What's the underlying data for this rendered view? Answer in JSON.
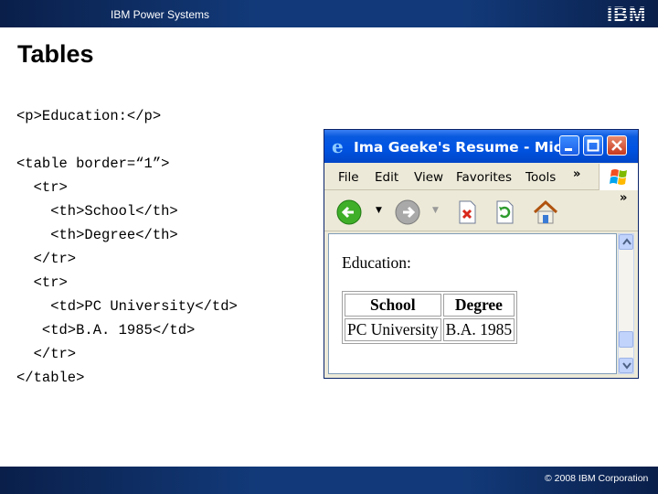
{
  "header": {
    "product": "IBM Power Systems",
    "logo_text": "IBM"
  },
  "slide": {
    "title": "Tables"
  },
  "code_lines": [
    "<p>Education:</p>",
    "<table border=“1”>",
    "  <tr>",
    "    <th>School</th>",
    "    <th>Degree</th>",
    "  </tr>",
    "  <tr>",
    "    <td>PC University</td>",
    "   <td>B.A. 1985</td>",
    "  </tr>",
    "</table>"
  ],
  "browser": {
    "window_title": "Ima Geeke's Resume - Mic...",
    "menu": [
      "File",
      "Edit",
      "View",
      "Favorites",
      "Tools"
    ],
    "chevron": "»",
    "toolbar_icons": [
      "back-icon",
      "forward-icon",
      "stop-icon",
      "refresh-icon",
      "home-icon"
    ],
    "page": {
      "label": "Education:",
      "headers": [
        "School",
        "Degree"
      ],
      "row": [
        "PC University",
        "B.A. 1985"
      ]
    }
  },
  "footer": {
    "copyright": "© 2008 IBM Corporation"
  },
  "colors": {
    "bar": "#123a7a",
    "xp_title": "#0054e3",
    "xp_chrome": "#ece9d8"
  }
}
